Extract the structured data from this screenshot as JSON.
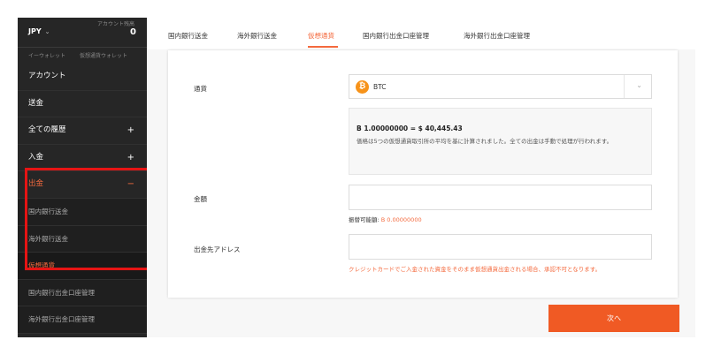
{
  "wallet": {
    "currency": "JPY",
    "available_label": "アカウント残高",
    "balance": "0",
    "tabs": [
      "イーウォレット",
      "仮想通貨ウォレット"
    ]
  },
  "sidebar": {
    "items": [
      {
        "label": "アカウント"
      },
      {
        "label": "送金"
      },
      {
        "label": "全ての履歴",
        "toggle": "+"
      },
      {
        "label": "入金",
        "toggle": "+"
      },
      {
        "label": "出金",
        "toggle": "−"
      },
      {
        "label": "国内銀行送金"
      },
      {
        "label": "海外銀行送金"
      },
      {
        "label": "仮想通貨"
      },
      {
        "label": "国内銀行出金口座管理"
      },
      {
        "label": "海外銀行出金口座管理"
      }
    ]
  },
  "tabs": [
    {
      "label": "国内銀行送金"
    },
    {
      "label": "海外銀行送金"
    },
    {
      "label": "仮想通貨"
    },
    {
      "label": "国内銀行出金口座管理"
    },
    {
      "label": "海外銀行出金口座管理"
    }
  ],
  "form": {
    "currency_label": "通貨",
    "currency_icon": "bitcoin-icon",
    "currency_value": "BTC",
    "rate": "B 1.00000000 = $ 40,445.43",
    "rate_note": "価格は5つの仮想通貨取引所の平均を基に計算されました。全ての出金は手動で処理が行われます。",
    "amount_label": "金額",
    "amount_value": "",
    "available_label": "振替可能額:",
    "available_amount": "B 0.00000000",
    "address_label": "出金先アドレス",
    "address_value": "",
    "warning": "クレジットカードでご入金された資金をそのまま仮想通貨出金される場合、承認不可となります。"
  },
  "next_button": "次へ",
  "colors": {
    "accent": "#f46a3e",
    "button": "#f05a24",
    "highlight": "#e61414",
    "sidebar_bg": "#262626"
  }
}
